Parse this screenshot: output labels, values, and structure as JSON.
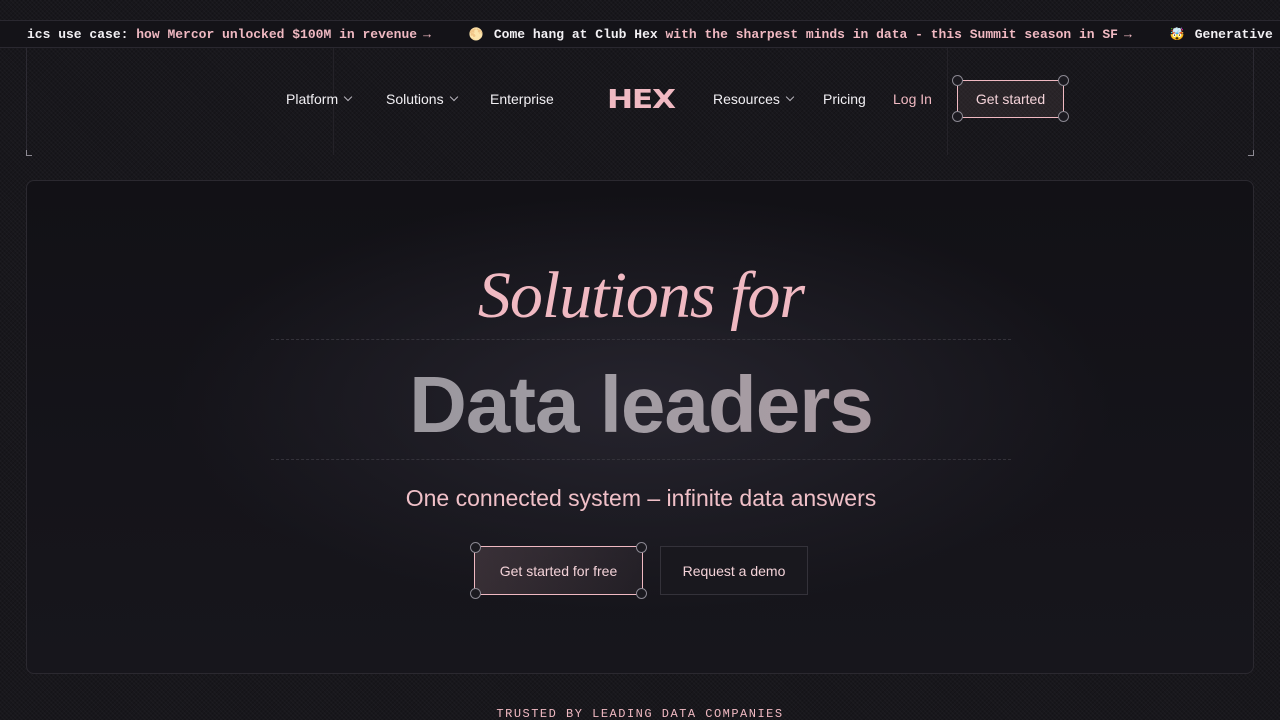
{
  "ticker": {
    "items": [
      {
        "emoji": "",
        "lead": "ics use case:",
        "link": "how Mercor unlocked $100M in revenue",
        "arrow": "→"
      },
      {
        "emoji": "🌕",
        "lead": "Come hang at Club Hex",
        "link": "with the sharpest minds in data - this Summit season in SF",
        "arrow": "→"
      },
      {
        "emoji": "🤯",
        "lead": "Generative",
        "link": "",
        "arrow": ""
      }
    ]
  },
  "nav": {
    "platform": "Platform",
    "solutions": "Solutions",
    "enterprise": "Enterprise",
    "logo": "HEX",
    "resources": "Resources",
    "pricing": "Pricing",
    "login": "Log In",
    "get_started": "Get started"
  },
  "hero": {
    "kicker": "Solutions for",
    "title": "Data leaders",
    "subtitle": "One connected system – infinite data answers",
    "primary_cta": "Get started for free",
    "secondary_cta": "Request a demo"
  },
  "trusted": "TRUSTED BY LEADING DATA COMPANIES",
  "colors": {
    "accent": "#f0b9c2",
    "background": "#18171c",
    "text": "#f1eff3"
  },
  "icons": [
    "chevron-down-icon",
    "arrow-right-icon"
  ]
}
